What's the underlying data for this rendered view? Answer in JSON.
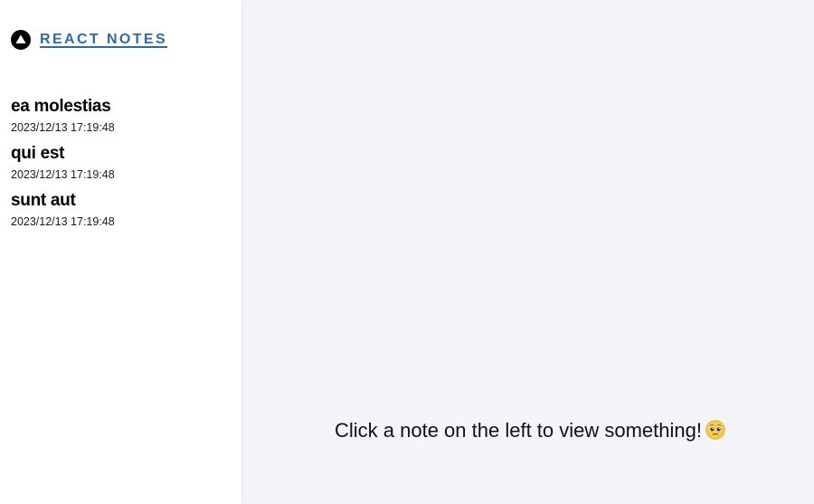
{
  "sidebar": {
    "brand": {
      "logo_icon": "react-notes-logo-icon",
      "title": "REACT NOTES",
      "color": "#2f6aa8"
    },
    "notes": [
      {
        "title": "ea molestias",
        "updated": "2023/12/13 17:19:48"
      },
      {
        "title": "qui est",
        "updated": "2023/12/13 17:19:48"
      },
      {
        "title": "sunt aut",
        "updated": "2023/12/13 17:19:48"
      }
    ]
  },
  "main": {
    "empty_message": "Click a note on the left to view something!",
    "emoji_icon": "pleading-face-emoji-icon",
    "background": "#f4f5f9"
  }
}
